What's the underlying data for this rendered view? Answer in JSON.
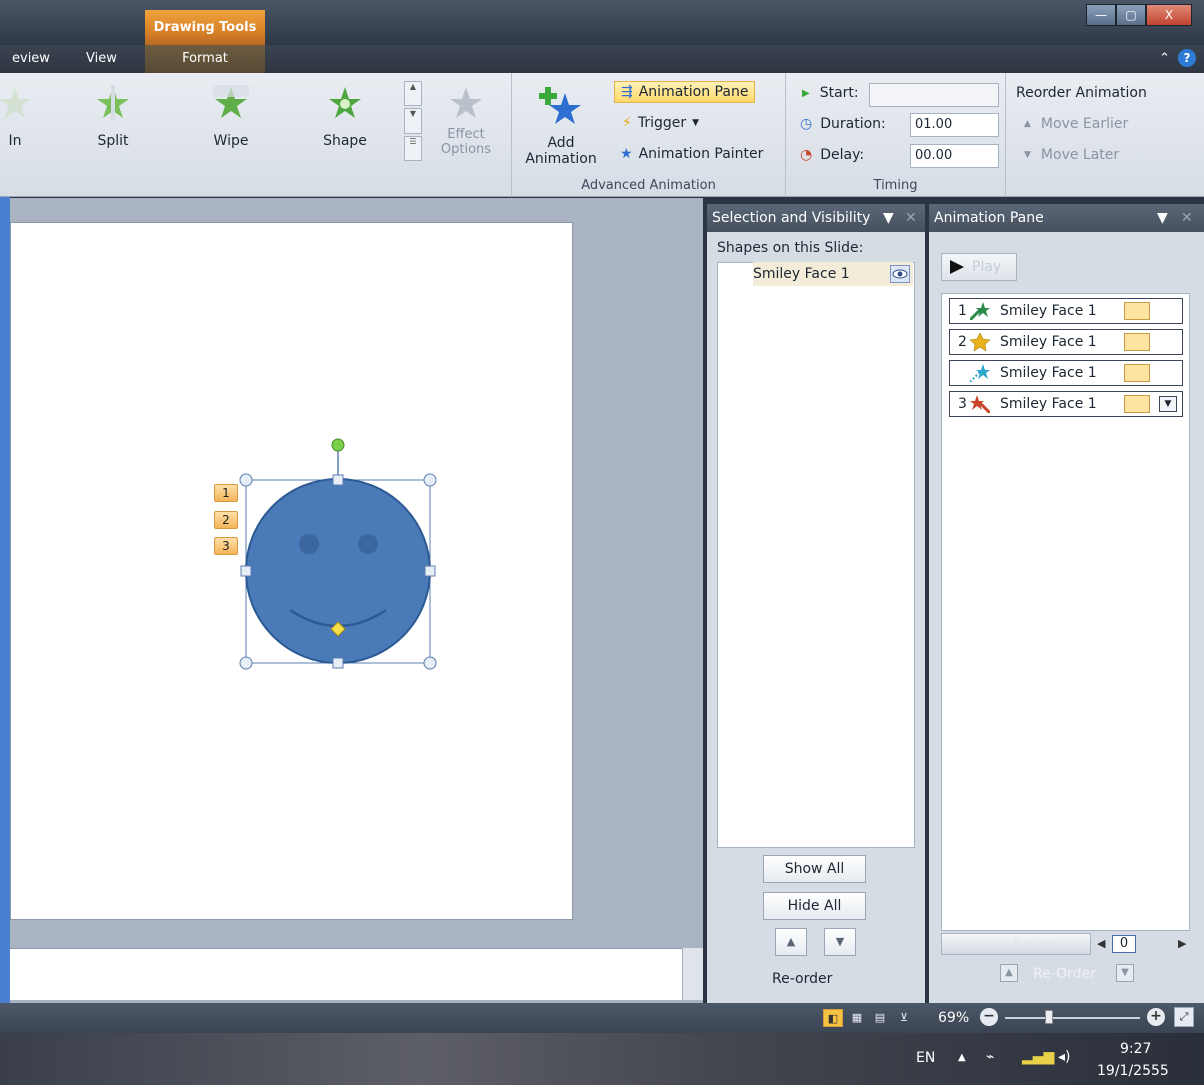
{
  "window": {
    "contextual_tab_group": "Drawing Tools",
    "controls": {
      "minimize": "—",
      "restore": "▢",
      "close": "X"
    }
  },
  "tabs": {
    "review": "eview",
    "view": "View",
    "format": "Format"
  },
  "ribbon": {
    "gallery": [
      {
        "label": "In"
      },
      {
        "label": "Split"
      },
      {
        "label": "Wipe"
      },
      {
        "label": "Shape"
      }
    ],
    "effect_options": {
      "line1": "Effect",
      "line2": "Options"
    },
    "add_animation": {
      "line1": "Add",
      "line2": "Animation"
    },
    "animation_pane": "Animation Pane",
    "trigger": "Trigger",
    "animation_painter": "Animation Painter",
    "advanced_animation_group": "Advanced Animation",
    "timing": {
      "start_label": "Start:",
      "start_value": "",
      "duration_label": "Duration:",
      "duration_value": "01.00",
      "delay_label": "Delay:",
      "delay_value": "00.00",
      "group_label": "Timing"
    },
    "reorder": {
      "title": "Reorder Animation",
      "move_earlier": "Move Earlier",
      "move_later": "Move Later"
    }
  },
  "slide": {
    "tags": [
      "1",
      "2",
      "3"
    ],
    "shape_color": "#4a7ab7"
  },
  "selection_pane": {
    "title": "Selection and Visibility",
    "subtitle": "Shapes on this Slide:",
    "items": [
      "Smiley Face 1"
    ],
    "show_all": "Show All",
    "hide_all": "Hide All",
    "reorder": "Re-order"
  },
  "animation_pane": {
    "title": "Animation Pane",
    "play": "Play",
    "items": [
      {
        "num": "1",
        "label": "Smiley Face 1",
        "icon_color": "#2a8a4a"
      },
      {
        "num": "2",
        "label": "Smiley Face 1",
        "icon_color": "#e8b21a"
      },
      {
        "num": "",
        "label": "Smiley Face 1",
        "icon_color": "#2aa7c9"
      },
      {
        "num": "3",
        "label": "Smiley Face 1",
        "icon_color": "#c9452a"
      }
    ],
    "seconds": "Seconds",
    "zoom_value": "0",
    "reorder": "Re-Order"
  },
  "statusbar": {
    "zoom": "69%"
  },
  "taskbar": {
    "language": "EN",
    "time": "9:27",
    "date": "19/1/2555"
  }
}
